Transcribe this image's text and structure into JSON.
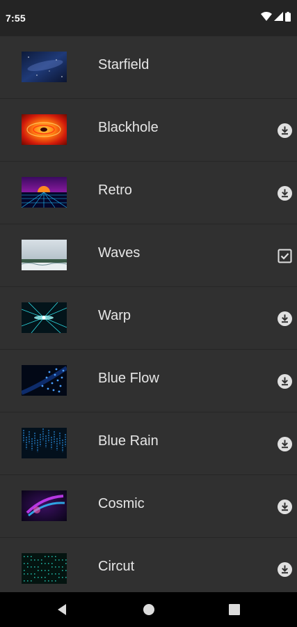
{
  "status_bar": {
    "time": "7:55",
    "icons": [
      "wifi-icon",
      "cell-signal-icon",
      "battery-icon"
    ]
  },
  "wallpapers": [
    {
      "name": "Starfield",
      "thumbnail": "starfield",
      "action": "none"
    },
    {
      "name": "Blackhole",
      "thumbnail": "blackhole",
      "action": "download"
    },
    {
      "name": "Retro",
      "thumbnail": "retro",
      "action": "download"
    },
    {
      "name": "Waves",
      "thumbnail": "waves",
      "action": "selected"
    },
    {
      "name": "Warp",
      "thumbnail": "warp",
      "action": "download"
    },
    {
      "name": "Blue Flow",
      "thumbnail": "blueflow",
      "action": "download"
    },
    {
      "name": "Blue Rain",
      "thumbnail": "bluerain",
      "action": "download"
    },
    {
      "name": "Cosmic",
      "thumbnail": "cosmic",
      "action": "download"
    },
    {
      "name": "Circut",
      "thumbnail": "circut",
      "action": "download"
    }
  ],
  "nav_bar": {
    "buttons": [
      "back-icon",
      "home-icon",
      "recents-icon"
    ]
  },
  "colors": {
    "list_background": "#303030",
    "status_bar": "#242424",
    "text": "#e6e6e6",
    "icon": "#e0e0e0"
  }
}
